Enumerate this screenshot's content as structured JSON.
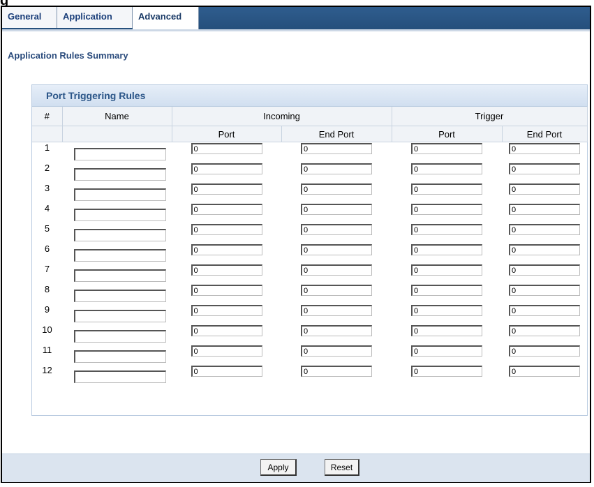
{
  "figure_heading": "g",
  "tabs": [
    {
      "label": "General",
      "active": false
    },
    {
      "label": "Application",
      "active": false
    },
    {
      "label": "Advanced",
      "active": true
    }
  ],
  "summary_title": "Application Rules Summary",
  "section_title": "Port Triggering Rules",
  "columns": {
    "index": "#",
    "name": "Name",
    "incoming": "Incoming",
    "trigger": "Trigger",
    "port": "Port",
    "end_port": "End Port"
  },
  "rows": [
    {
      "num": "1",
      "name": "",
      "in_port": "0",
      "in_end": "0",
      "tr_port": "0",
      "tr_end": "0"
    },
    {
      "num": "2",
      "name": "",
      "in_port": "0",
      "in_end": "0",
      "tr_port": "0",
      "tr_end": "0"
    },
    {
      "num": "3",
      "name": "",
      "in_port": "0",
      "in_end": "0",
      "tr_port": "0",
      "tr_end": "0"
    },
    {
      "num": "4",
      "name": "",
      "in_port": "0",
      "in_end": "0",
      "tr_port": "0",
      "tr_end": "0"
    },
    {
      "num": "5",
      "name": "",
      "in_port": "0",
      "in_end": "0",
      "tr_port": "0",
      "tr_end": "0"
    },
    {
      "num": "6",
      "name": "",
      "in_port": "0",
      "in_end": "0",
      "tr_port": "0",
      "tr_end": "0"
    },
    {
      "num": "7",
      "name": "",
      "in_port": "0",
      "in_end": "0",
      "tr_port": "0",
      "tr_end": "0"
    },
    {
      "num": "8",
      "name": "",
      "in_port": "0",
      "in_end": "0",
      "tr_port": "0",
      "tr_end": "0"
    },
    {
      "num": "9",
      "name": "",
      "in_port": "0",
      "in_end": "0",
      "tr_port": "0",
      "tr_end": "0"
    },
    {
      "num": "10",
      "name": "",
      "in_port": "0",
      "in_end": "0",
      "tr_port": "0",
      "tr_end": "0"
    },
    {
      "num": "11",
      "name": "",
      "in_port": "0",
      "in_end": "0",
      "tr_port": "0",
      "tr_end": "0"
    },
    {
      "num": "12",
      "name": "",
      "in_port": "0",
      "in_end": "0",
      "tr_port": "0",
      "tr_end": "0"
    }
  ],
  "buttons": {
    "apply": "Apply",
    "reset": "Reset"
  }
}
